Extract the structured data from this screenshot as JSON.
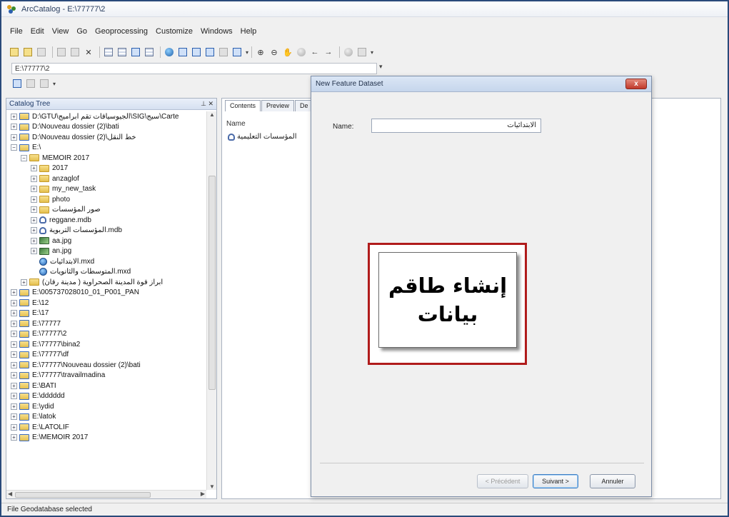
{
  "window": {
    "title": "ArcCatalog - E:\\77777\\2"
  },
  "menu": {
    "items": [
      "File",
      "Edit",
      "View",
      "Go",
      "Geoprocessing",
      "Customize",
      "Windows",
      "Help"
    ]
  },
  "location": {
    "value": "E:\\77777\\2"
  },
  "catalog_tree": {
    "title": "Catalog Tree",
    "pin_label": "&#x2715;",
    "items": [
      {
        "label": "D:\\GTU\\الجيوسياقات تقم ابراميج\\SIG\\سيج\\Carte",
        "depth": 0,
        "exp": "+",
        "icon": "conn"
      },
      {
        "label": "D:\\Nouveau dossier (2)\\bati",
        "depth": 0,
        "exp": "+",
        "icon": "conn"
      },
      {
        "label": "D:\\Nouveau dossier (2)\\خط النقل",
        "depth": 0,
        "exp": "+",
        "icon": "conn"
      },
      {
        "label": "E:\\",
        "depth": 0,
        "exp": "-",
        "icon": "conn"
      },
      {
        "label": "MEMOIR 2017",
        "depth": 1,
        "exp": "-",
        "icon": "folder"
      },
      {
        "label": "2017",
        "depth": 2,
        "exp": "+",
        "icon": "folder"
      },
      {
        "label": "anzaglof",
        "depth": 2,
        "exp": "+",
        "icon": "folder"
      },
      {
        "label": "my_new_task",
        "depth": 2,
        "exp": "+",
        "icon": "folder"
      },
      {
        "label": "photo",
        "depth": 2,
        "exp": "+",
        "icon": "folder"
      },
      {
        "label": "صور المؤسسات",
        "depth": 2,
        "exp": "+",
        "icon": "folder"
      },
      {
        "label": "reggane.mdb",
        "depth": 2,
        "exp": "+",
        "icon": "mdb"
      },
      {
        "label": "المؤسسات التربوية.mdb",
        "depth": 2,
        "exp": "+",
        "icon": "mdb"
      },
      {
        "label": "aa.jpg",
        "depth": 2,
        "exp": "+",
        "icon": "raster"
      },
      {
        "label": "an.jpg",
        "depth": 2,
        "exp": "+",
        "icon": "raster"
      },
      {
        "label": "الابتدائيات.mxd",
        "depth": 2,
        "exp": "",
        "icon": "mxd"
      },
      {
        "label": "المتوسطات والثانويات.mxd",
        "depth": 2,
        "exp": "",
        "icon": "mxd"
      },
      {
        "label": "ابراز قوة المدينة الصحراوية ( مدينة رقان)",
        "depth": 1,
        "exp": "+",
        "icon": "folder"
      },
      {
        "label": "E:\\005737028010_01_P001_PAN",
        "depth": 0,
        "exp": "+",
        "icon": "conn"
      },
      {
        "label": "E:\\12",
        "depth": 0,
        "exp": "+",
        "icon": "conn"
      },
      {
        "label": "E:\\17",
        "depth": 0,
        "exp": "+",
        "icon": "conn"
      },
      {
        "label": "E:\\77777",
        "depth": 0,
        "exp": "+",
        "icon": "conn"
      },
      {
        "label": "E:\\77777\\2",
        "depth": 0,
        "exp": "+",
        "icon": "conn"
      },
      {
        "label": "E:\\77777\\bina2",
        "depth": 0,
        "exp": "+",
        "icon": "conn"
      },
      {
        "label": "E:\\77777\\df",
        "depth": 0,
        "exp": "+",
        "icon": "conn"
      },
      {
        "label": "E:\\77777\\Nouveau dossier (2)\\bati",
        "depth": 0,
        "exp": "+",
        "icon": "conn"
      },
      {
        "label": "E:\\77777\\travailmadina",
        "depth": 0,
        "exp": "+",
        "icon": "conn"
      },
      {
        "label": "E:\\BATI",
        "depth": 0,
        "exp": "+",
        "icon": "conn"
      },
      {
        "label": "E:\\dddddd",
        "depth": 0,
        "exp": "+",
        "icon": "conn"
      },
      {
        "label": "E:\\ydid",
        "depth": 0,
        "exp": "+",
        "icon": "conn"
      },
      {
        "label": "E:\\latok",
        "depth": 0,
        "exp": "+",
        "icon": "conn"
      },
      {
        "label": "E:\\LATOLIF",
        "depth": 0,
        "exp": "+",
        "icon": "conn"
      },
      {
        "label": "E:\\MEMOIR 2017",
        "depth": 0,
        "exp": "+",
        "icon": "conn"
      }
    ]
  },
  "contents_panel": {
    "tabs": [
      "Contents",
      "Preview",
      "De"
    ],
    "column_name": "Name",
    "item_label": "المؤسسات التعليمية"
  },
  "dialog": {
    "title": "New Feature Dataset",
    "close_label": "x",
    "name_label": "Name:",
    "name_value": "الابتدائيات",
    "buttons": {
      "previous": "< Précédent",
      "next": "Suivant >",
      "cancel": "Annuler"
    }
  },
  "callout": {
    "text": "إنشاء طاقم بيانات"
  },
  "status_bar": {
    "text": "File Geodatabase selected"
  }
}
